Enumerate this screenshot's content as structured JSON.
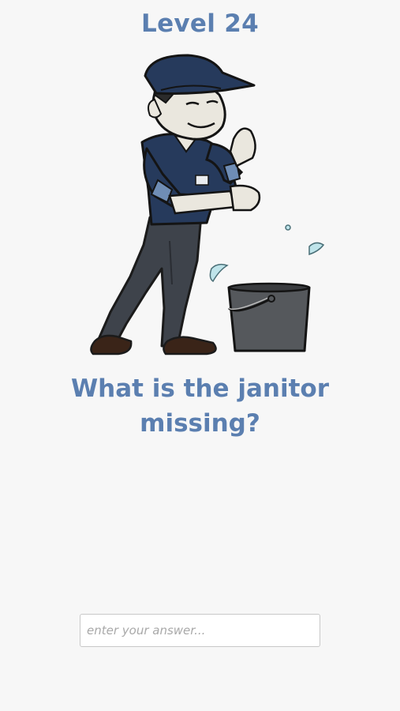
{
  "level": {
    "title": "Level 24"
  },
  "puzzle": {
    "question": "What is the janitor missing?",
    "illustration_icon": "janitor-with-bucket-icon"
  },
  "answer": {
    "placeholder": "enter your answer...",
    "value": ""
  },
  "colors": {
    "accent": "#5b7fb0",
    "background": "#f7f7f7",
    "uniform": "#263a5c",
    "pants": "#3e434b",
    "bucket": "#55585c"
  }
}
